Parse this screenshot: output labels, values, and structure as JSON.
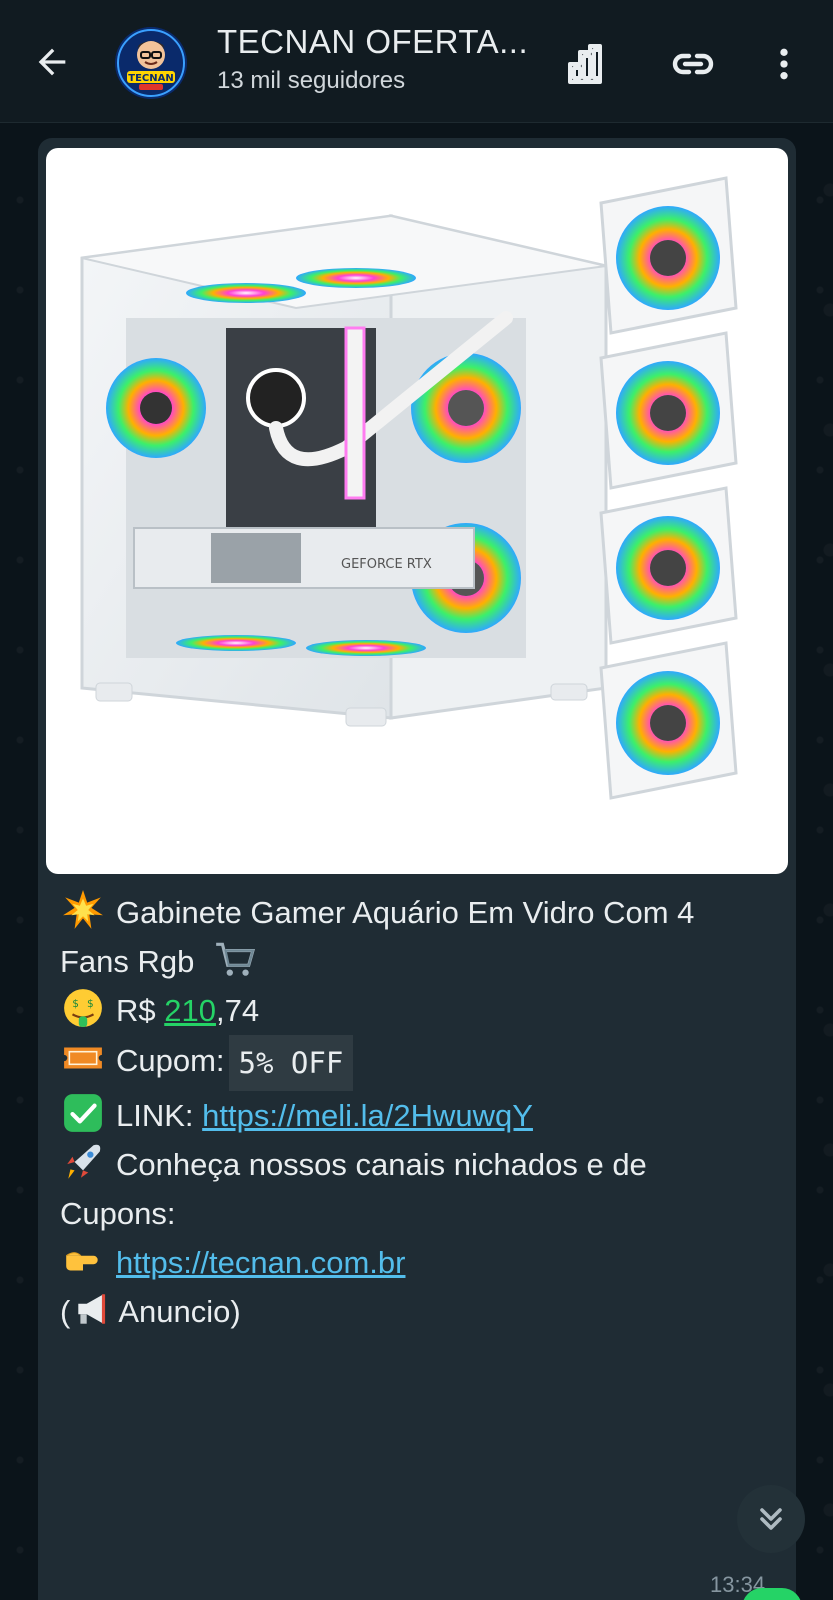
{
  "header": {
    "channel_name": "TECNAN OFERTA...",
    "followers": "13 mil seguidores",
    "avatar_text": "TECNAN"
  },
  "media": {
    "gpu_label": "GEFORCE RTX"
  },
  "message": {
    "title": "Gabinete Gamer Aquário Em Vidro Com 4",
    "title_cont": "Fans Rgb",
    "price_prefix": "R$ ",
    "price_main": "210",
    "price_cents": ",74",
    "coupon_label": "Cupom:",
    "coupon_code": "5% OFF",
    "link_label": "LINK:",
    "link_url": "https://meli.la/2HwuwqY",
    "channels_text": "Conheça nossos canais nichados e de",
    "channels_text_cont": "Cupons:",
    "site_url": "https://tecnan.com.br",
    "ad_open": "(",
    "ad_label": "Anuncio)",
    "time": "13:34"
  },
  "colors": {
    "header_bg": "#111b21",
    "bubble_bg": "#1f2c34",
    "link": "#53bdeb",
    "price_green": "#25d366"
  }
}
